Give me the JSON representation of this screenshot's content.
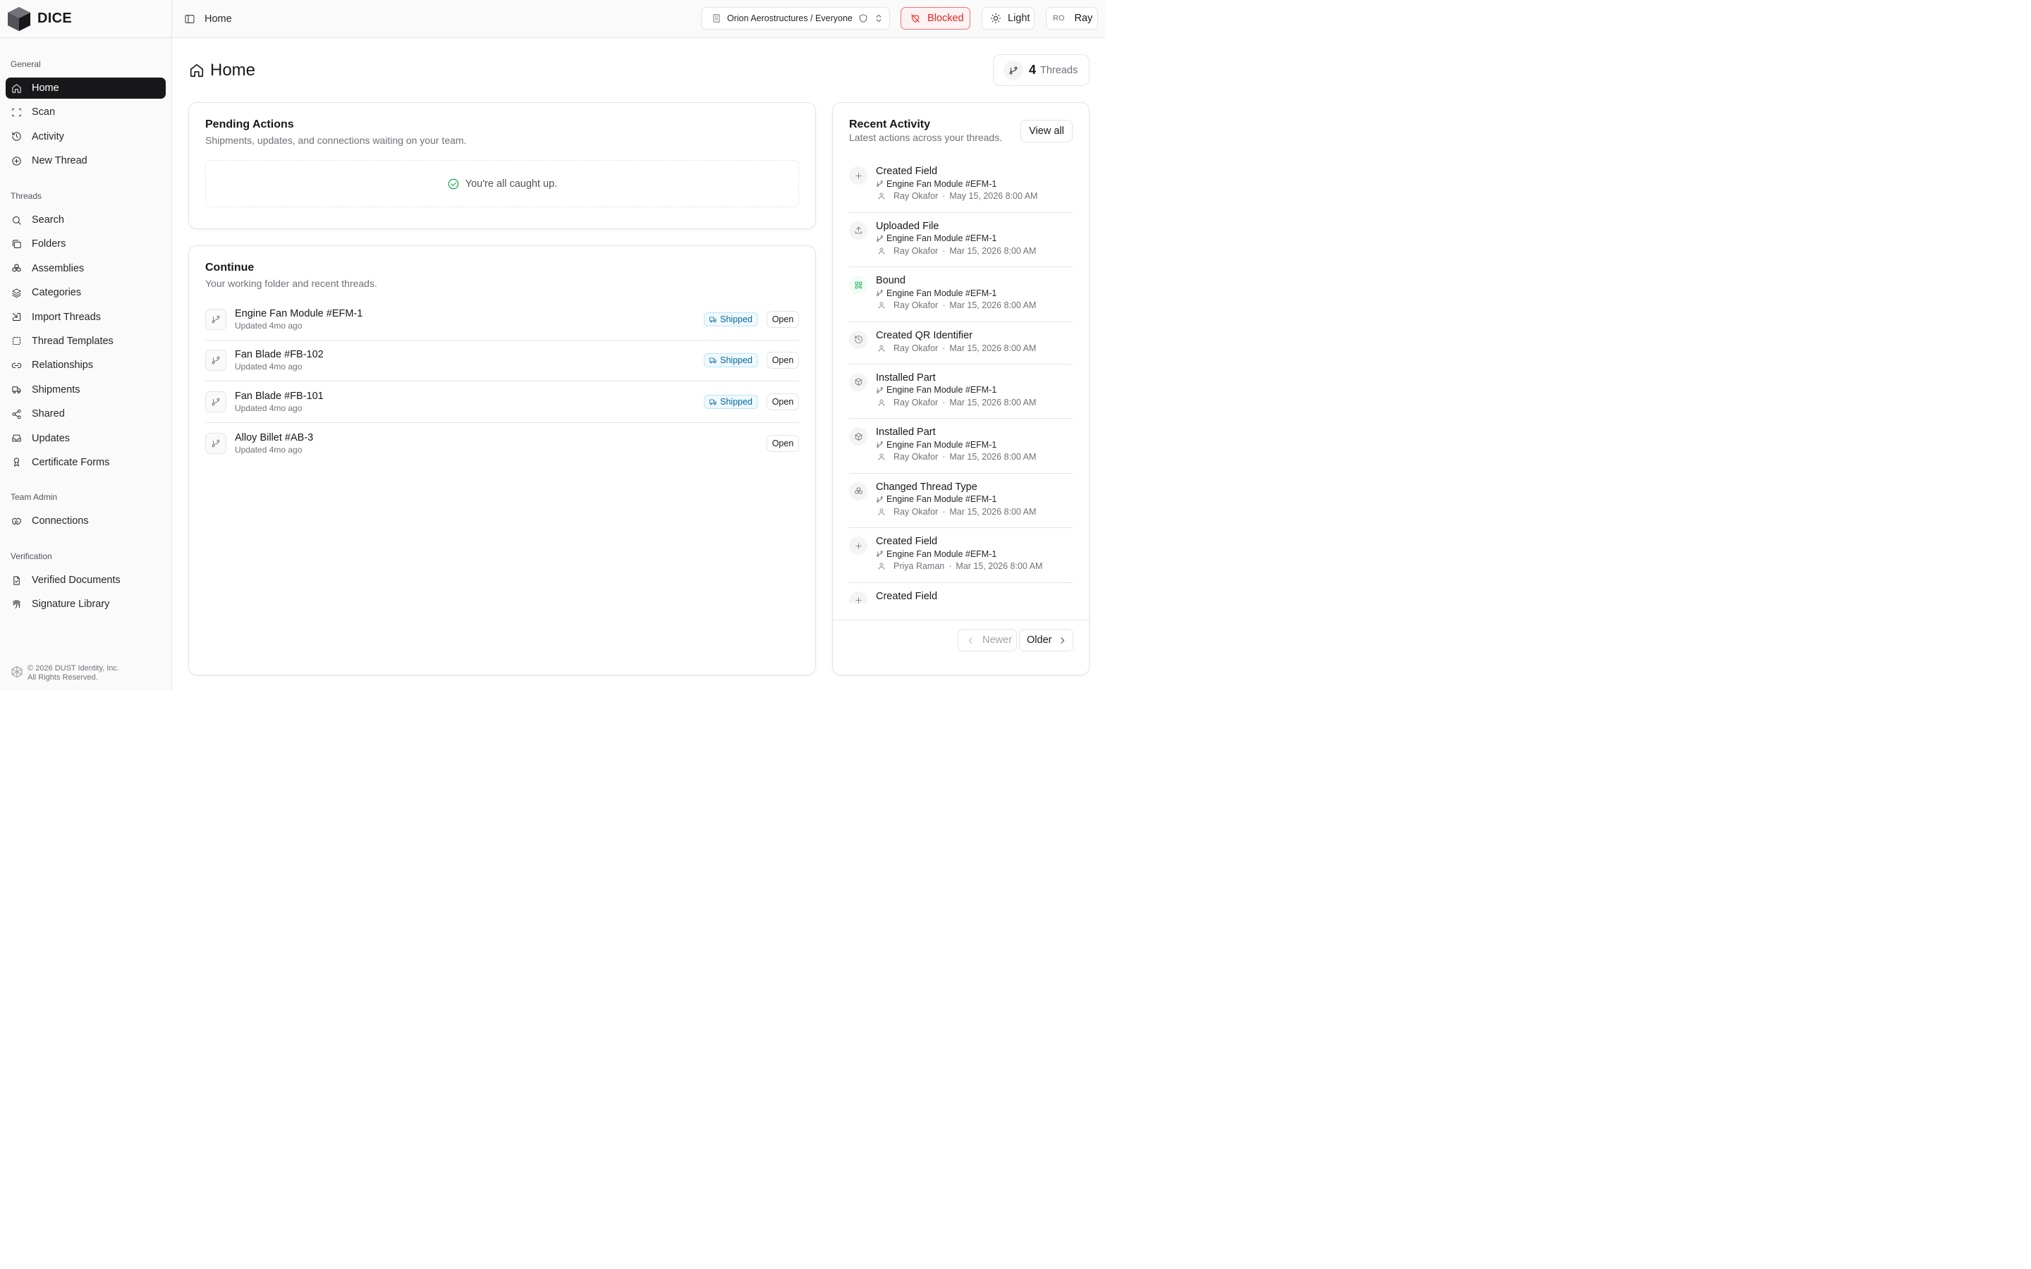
{
  "brand": {
    "name": "DICE"
  },
  "sidebar": {
    "sections": [
      {
        "label": "General",
        "items": [
          {
            "label": "Home",
            "icon": "home-icon",
            "active": true
          },
          {
            "label": "Scan",
            "icon": "scan-icon"
          },
          {
            "label": "Activity",
            "icon": "history-icon"
          },
          {
            "label": "New Thread",
            "icon": "plus-circle-icon"
          }
        ]
      },
      {
        "label": "Threads",
        "items": [
          {
            "label": "Search",
            "icon": "search-icon"
          },
          {
            "label": "Folders",
            "icon": "folders-icon"
          },
          {
            "label": "Assemblies",
            "icon": "boxes-icon"
          },
          {
            "label": "Categories",
            "icon": "layers-icon"
          },
          {
            "label": "Import Threads",
            "icon": "import-icon"
          },
          {
            "label": "Thread Templates",
            "icon": "template-icon"
          },
          {
            "label": "Relationships",
            "icon": "link-icon"
          },
          {
            "label": "Shipments",
            "icon": "truck-icon"
          },
          {
            "label": "Shared",
            "icon": "share-icon"
          },
          {
            "label": "Updates",
            "icon": "inbox-icon"
          },
          {
            "label": "Certificate Forms",
            "icon": "award-icon"
          }
        ]
      },
      {
        "label": "Team Admin",
        "items": [
          {
            "label": "Connections",
            "icon": "handshake-icon"
          }
        ]
      },
      {
        "label": "Verification",
        "items": [
          {
            "label": "Verified Documents",
            "icon": "file-check-icon"
          },
          {
            "label": "Signature Library",
            "icon": "fingerprint-icon"
          }
        ]
      }
    ],
    "footer": {
      "line1": "© 2026 DUST Identity, Inc.",
      "line2": "All Rights Reserved."
    }
  },
  "header": {
    "breadcrumb": "Home",
    "org": "Orion Aerostructures / Everyone",
    "blocked_label": "Blocked",
    "theme_label": "Light",
    "user_initials": "RO",
    "user_name": "Ray"
  },
  "page": {
    "title": "Home",
    "threads_count": "4",
    "threads_label": "Threads"
  },
  "pending": {
    "title": "Pending Actions",
    "subtitle": "Shipments, updates, and connections waiting on your team.",
    "empty_text": "You're all caught up."
  },
  "continue": {
    "title": "Continue",
    "subtitle": "Your working folder and recent threads.",
    "open_label": "Open",
    "threads": [
      {
        "name": "Engine Fan Module #EFM-1",
        "updated": "Updated 4mo ago",
        "badge": "Shipped"
      },
      {
        "name": "Fan Blade #FB-102",
        "updated": "Updated 4mo ago",
        "badge": "Shipped"
      },
      {
        "name": "Fan Blade #FB-101",
        "updated": "Updated 4mo ago",
        "badge": "Shipped"
      },
      {
        "name": "Alloy Billet #AB-3",
        "updated": "Updated 4mo ago",
        "badge": ""
      }
    ]
  },
  "recent": {
    "title": "Recent Activity",
    "subtitle": "Latest actions across your threads.",
    "view_all": "View all",
    "newer": "Newer",
    "older": "Older",
    "items": [
      {
        "title": "Created Field",
        "thread": "Engine Fan Module #EFM-1",
        "user": "Ray Okafor",
        "date": "May 15, 2026 8:00 AM",
        "icon": "plus-icon"
      },
      {
        "title": "Uploaded File",
        "thread": "Engine Fan Module #EFM-1",
        "user": "Ray Okafor",
        "date": "Mar 15, 2026 8:00 AM",
        "icon": "upload-icon"
      },
      {
        "title": "Bound",
        "thread": "Engine Fan Module #EFM-1",
        "user": "Ray Okafor",
        "date": "Mar 15, 2026 8:00 AM",
        "icon": "qr-icon"
      },
      {
        "title": "Created QR Identifier",
        "thread": "",
        "user": "Ray Okafor",
        "date": "Mar 15, 2026 8:00 AM",
        "icon": "history-icon"
      },
      {
        "title": "Installed Part",
        "thread": "Engine Fan Module #EFM-1",
        "user": "Ray Okafor",
        "date": "Mar 15, 2026 8:00 AM",
        "icon": "package-icon"
      },
      {
        "title": "Installed Part",
        "thread": "Engine Fan Module #EFM-1",
        "user": "Ray Okafor",
        "date": "Mar 15, 2026 8:00 AM",
        "icon": "package-icon"
      },
      {
        "title": "Changed Thread Type",
        "thread": "Engine Fan Module #EFM-1",
        "user": "Ray Okafor",
        "date": "Mar 15, 2026 8:00 AM",
        "icon": "boxes-icon"
      },
      {
        "title": "Created Field",
        "thread": "Engine Fan Module #EFM-1",
        "user": "Priya Raman",
        "date": "Mar 15, 2026 8:00 AM",
        "icon": "plus-icon"
      },
      {
        "title": "Created Field",
        "thread": "",
        "user": "",
        "date": "",
        "icon": "plus-icon"
      }
    ]
  },
  "colors": {
    "accent": "#18181b",
    "blocked": "#dc2626",
    "shipped": "#0369a1",
    "success": "#16a34a"
  }
}
